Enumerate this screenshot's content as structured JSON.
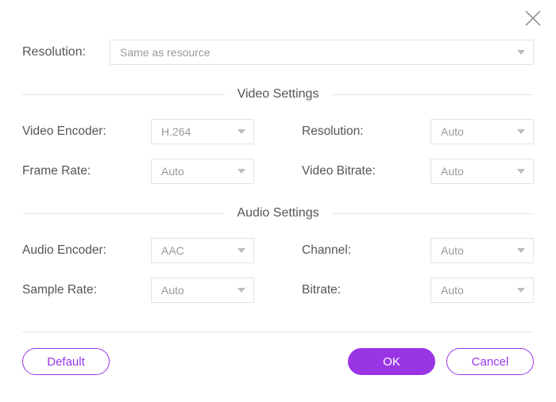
{
  "close_icon": "close",
  "top": {
    "resolution_label": "Resolution:",
    "resolution_value": "Same as resource"
  },
  "sections": {
    "video_title": "Video Settings",
    "audio_title": "Audio Settings"
  },
  "video": {
    "encoder_label": "Video Encoder:",
    "encoder_value": "H.264",
    "resolution_label": "Resolution:",
    "resolution_value": "Auto",
    "framerate_label": "Frame Rate:",
    "framerate_value": "Auto",
    "bitrate_label": "Video Bitrate:",
    "bitrate_value": "Auto"
  },
  "audio": {
    "encoder_label": "Audio Encoder:",
    "encoder_value": "AAC",
    "channel_label": "Channel:",
    "channel_value": "Auto",
    "samplerate_label": "Sample Rate:",
    "samplerate_value": "Auto",
    "bitrate_label": "Bitrate:",
    "bitrate_value": "Auto"
  },
  "buttons": {
    "default": "Default",
    "ok": "OK",
    "cancel": "Cancel"
  },
  "colors": {
    "accent": "#9a35e6"
  }
}
